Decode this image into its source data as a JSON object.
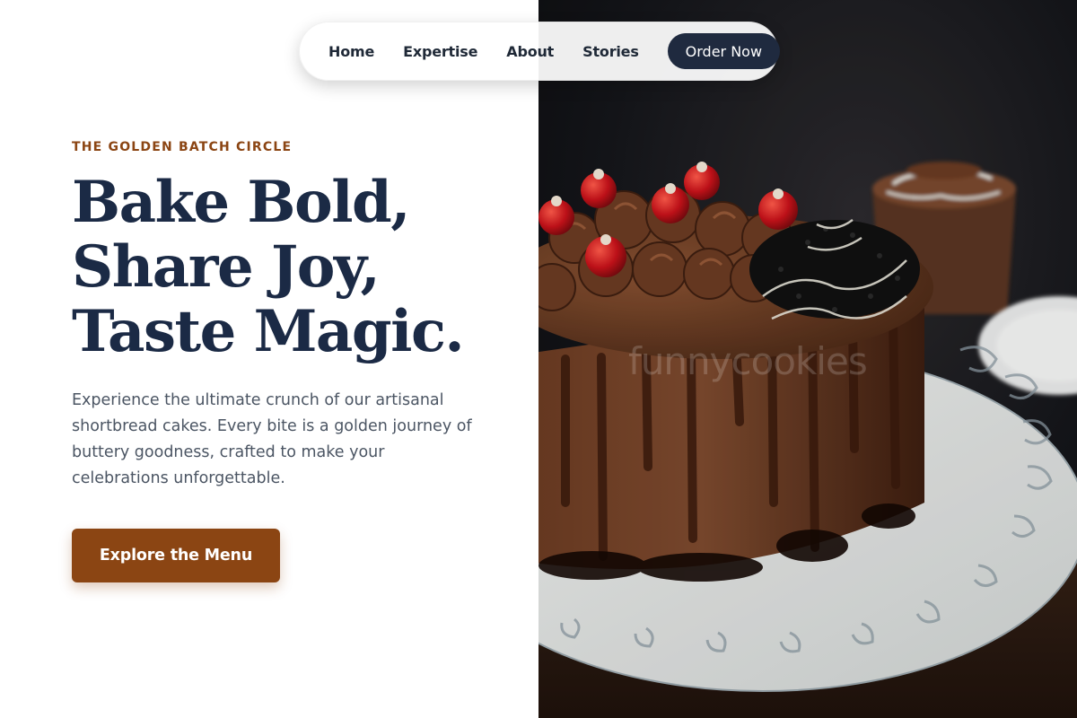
{
  "nav": {
    "links": [
      "Home",
      "Expertise",
      "About",
      "Stories"
    ],
    "cta_label": "Order Now"
  },
  "hero": {
    "eyebrow": "THE GOLDEN BATCH CIRCLE",
    "headline_lines": [
      "Bake Bold,",
      "Share Joy,",
      "Taste Magic."
    ],
    "description": "Experience the ultimate crunch of our artisanal shortbread cakes. Every bite is a golden journey of buttery goodness, crafted to make your celebrations unforgettable.",
    "cta_label": "Explore the Menu"
  },
  "image": {
    "subject": "chocolate-cake-photo",
    "watermark": "funnycookies"
  },
  "colors": {
    "accent": "#8b4513",
    "navy": "#1b2a45",
    "nav_cta": "#1f2a3f",
    "body_text": "#4b5563"
  }
}
